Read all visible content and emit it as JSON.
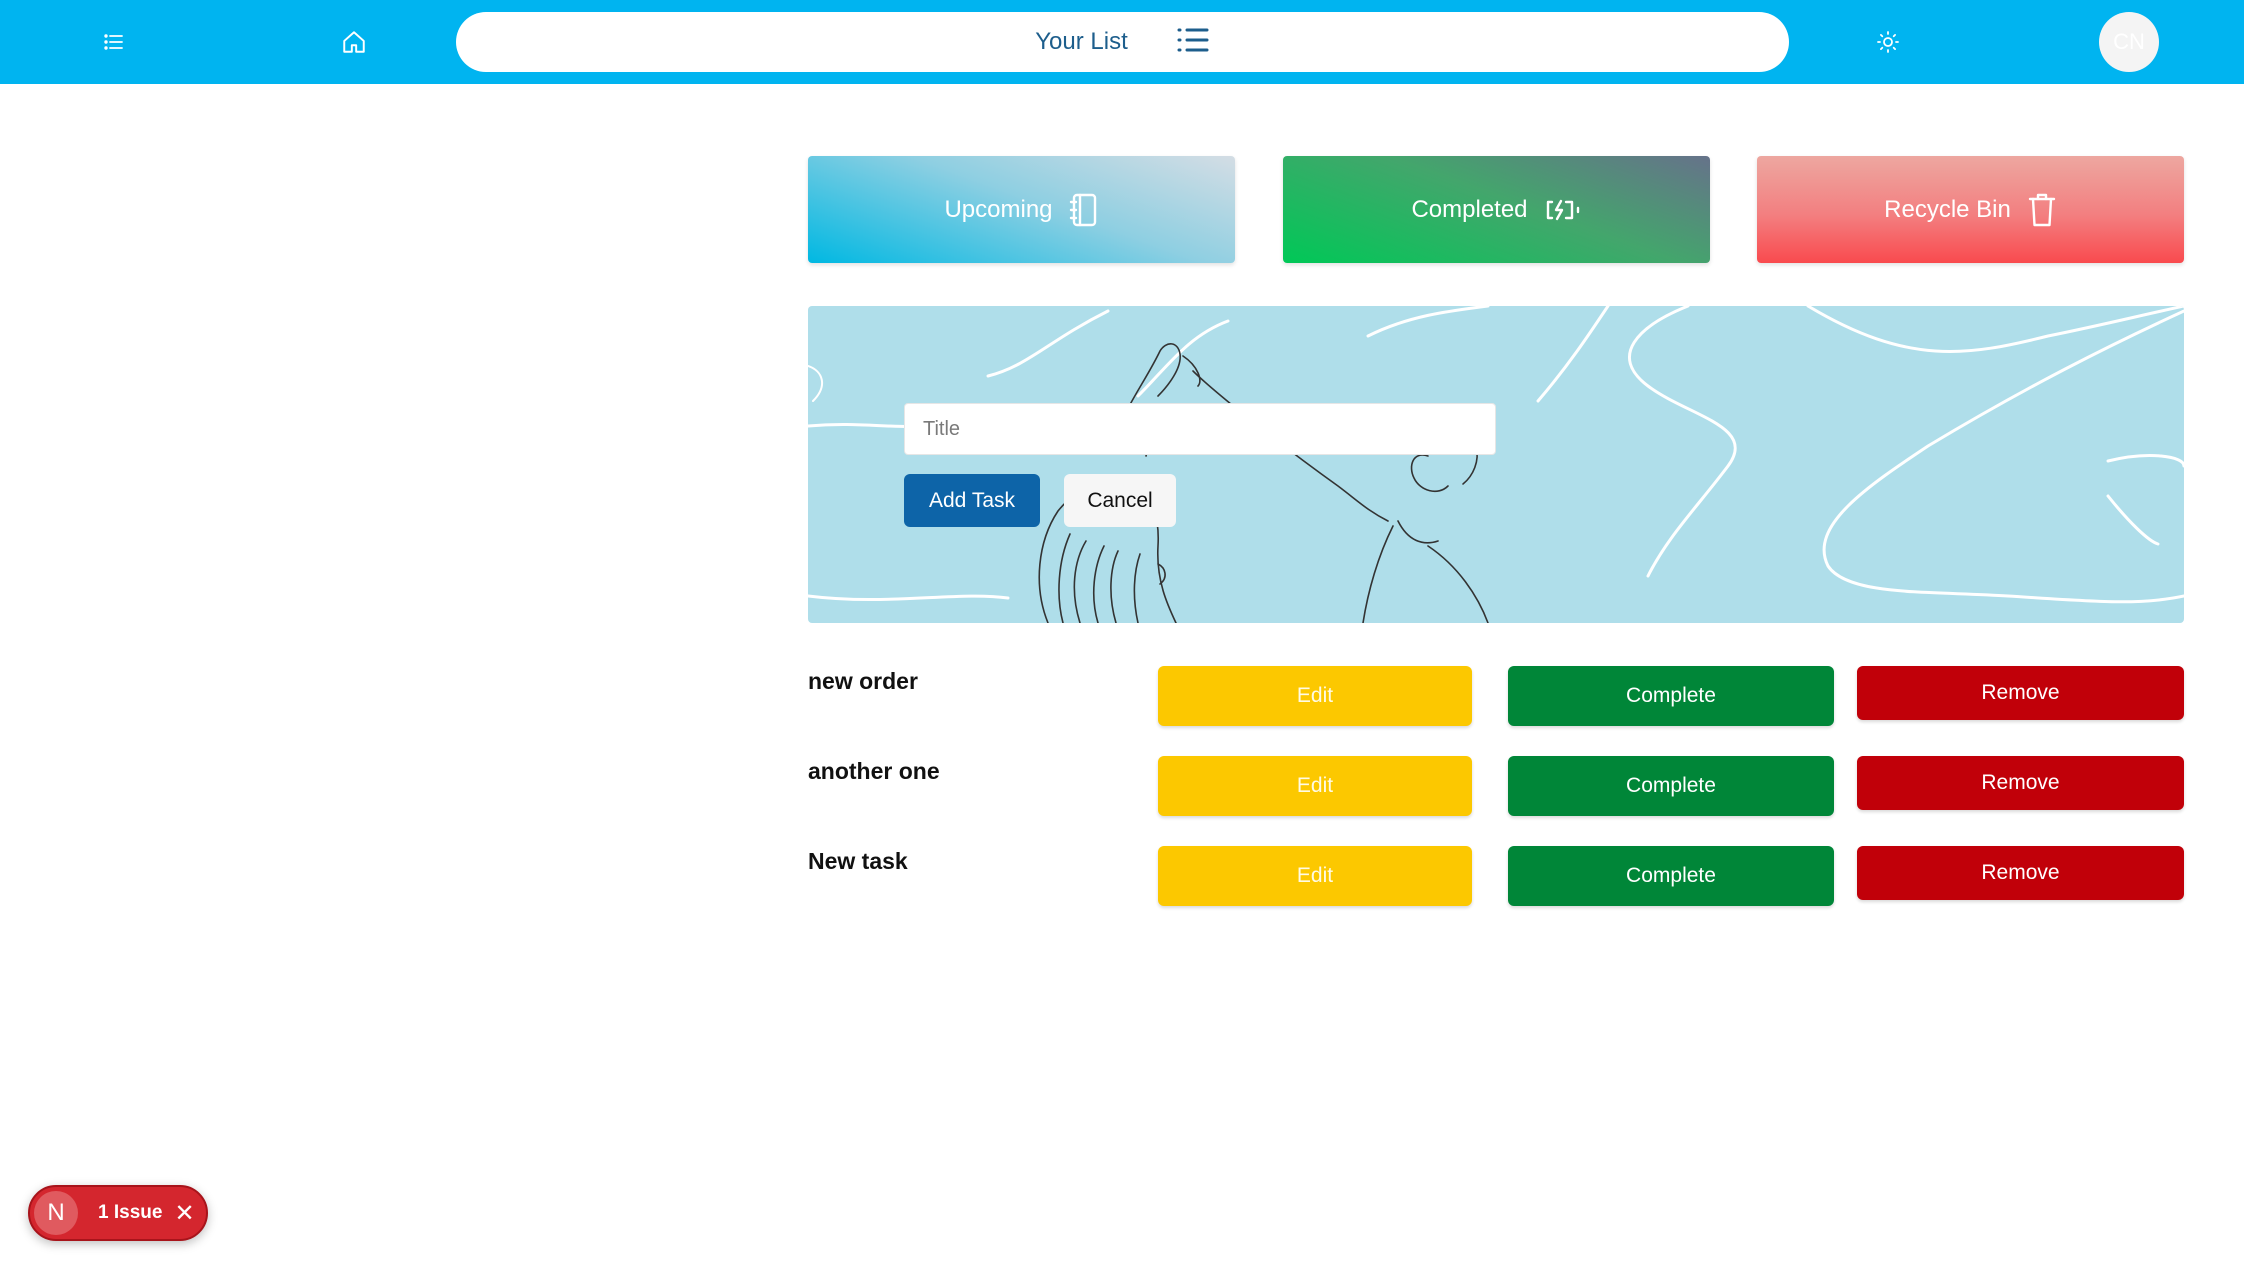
{
  "header": {
    "menu_icon": "list-icon",
    "home_icon": "home-icon",
    "title": "Your List",
    "list_icon": "list-icon",
    "theme_icon": "sun-icon",
    "avatar_initials": "CN"
  },
  "categories": [
    {
      "label": "Upcoming",
      "icon": "notebook-icon"
    },
    {
      "label": "Completed",
      "icon": "battery-charging-icon"
    },
    {
      "label": "Recycle Bin",
      "icon": "trash-icon"
    }
  ],
  "task_form": {
    "title_placeholder": "Title",
    "title_value": "",
    "add_label": "Add Task",
    "cancel_label": "Cancel"
  },
  "tasks": [
    {
      "title": "new order",
      "edit_label": "Edit",
      "complete_label": "Complete",
      "remove_label": "Remove"
    },
    {
      "title": "another one",
      "edit_label": "Edit",
      "complete_label": "Complete",
      "remove_label": "Remove"
    },
    {
      "title": "New task",
      "edit_label": "Edit",
      "complete_label": "Complete",
      "remove_label": "Remove"
    }
  ],
  "issue_badge": {
    "logo": "N",
    "label": "1 Issue",
    "close_icon": "close-icon"
  },
  "colors": {
    "topbar": "#00b4f0",
    "edit": "#fcc800",
    "complete": "#008638",
    "remove": "#c10009",
    "add_task": "#0d64a8"
  }
}
